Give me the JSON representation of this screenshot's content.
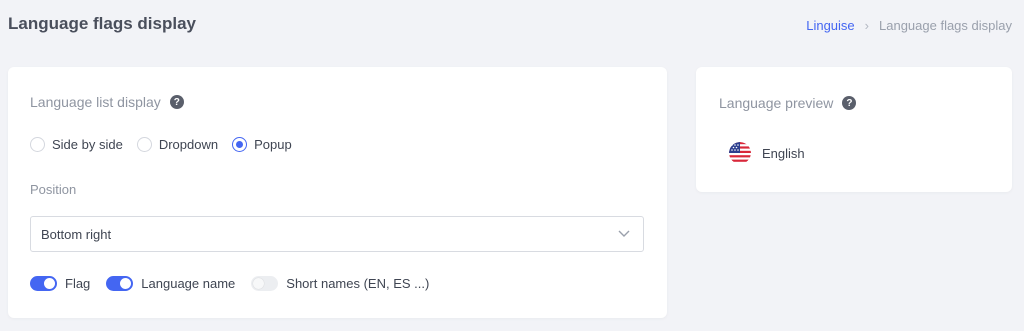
{
  "header": {
    "title": "Language flags display",
    "breadcrumb": [
      {
        "label": "Linguise"
      },
      {
        "label": "Language flags display"
      }
    ],
    "separator": "›"
  },
  "main": {
    "list_display": {
      "label": "Language list display",
      "help": "?",
      "options": [
        {
          "label": "Side by side",
          "checked": false
        },
        {
          "label": "Dropdown",
          "checked": false
        },
        {
          "label": "Popup",
          "checked": true
        }
      ]
    },
    "position": {
      "label": "Position",
      "value": "Bottom right"
    },
    "toggles": [
      {
        "label": "Flag",
        "on": true
      },
      {
        "label": "Language name",
        "on": true
      },
      {
        "label": "Short names (EN, ES ...)",
        "on": false
      }
    ]
  },
  "preview": {
    "label": "Language preview",
    "help": "?",
    "language": "English",
    "flag_icon": "us-flag-icon"
  },
  "colors": {
    "accent": "#4466f2",
    "background": "#f2f3f7"
  }
}
